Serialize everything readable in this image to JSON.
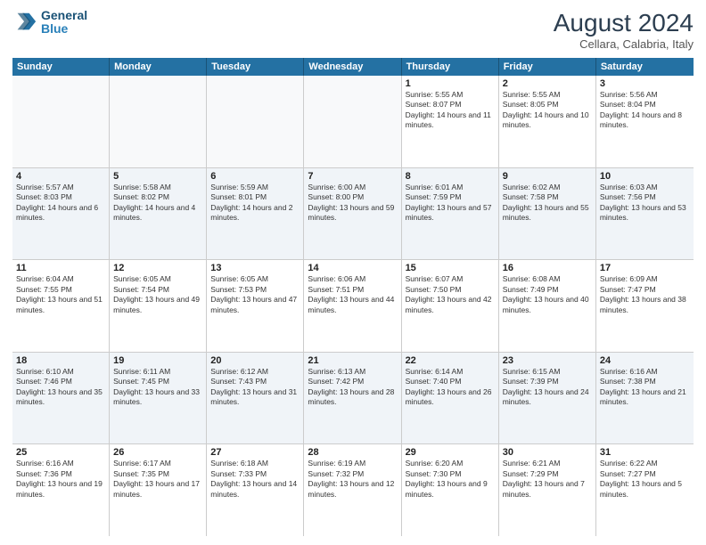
{
  "logo": {
    "line1": "General",
    "line2": "Blue"
  },
  "title": "August 2024",
  "subtitle": "Cellara, Calabria, Italy",
  "days": [
    "Sunday",
    "Monday",
    "Tuesday",
    "Wednesday",
    "Thursday",
    "Friday",
    "Saturday"
  ],
  "weeks": [
    [
      {
        "day": "",
        "empty": true
      },
      {
        "day": "",
        "empty": true
      },
      {
        "day": "",
        "empty": true
      },
      {
        "day": "",
        "empty": true
      },
      {
        "day": "1",
        "sunrise": "Sunrise: 5:55 AM",
        "sunset": "Sunset: 8:07 PM",
        "daylight": "Daylight: 14 hours and 11 minutes."
      },
      {
        "day": "2",
        "sunrise": "Sunrise: 5:55 AM",
        "sunset": "Sunset: 8:05 PM",
        "daylight": "Daylight: 14 hours and 10 minutes."
      },
      {
        "day": "3",
        "sunrise": "Sunrise: 5:56 AM",
        "sunset": "Sunset: 8:04 PM",
        "daylight": "Daylight: 14 hours and 8 minutes."
      }
    ],
    [
      {
        "day": "4",
        "sunrise": "Sunrise: 5:57 AM",
        "sunset": "Sunset: 8:03 PM",
        "daylight": "Daylight: 14 hours and 6 minutes."
      },
      {
        "day": "5",
        "sunrise": "Sunrise: 5:58 AM",
        "sunset": "Sunset: 8:02 PM",
        "daylight": "Daylight: 14 hours and 4 minutes."
      },
      {
        "day": "6",
        "sunrise": "Sunrise: 5:59 AM",
        "sunset": "Sunset: 8:01 PM",
        "daylight": "Daylight: 14 hours and 2 minutes."
      },
      {
        "day": "7",
        "sunrise": "Sunrise: 6:00 AM",
        "sunset": "Sunset: 8:00 PM",
        "daylight": "Daylight: 13 hours and 59 minutes."
      },
      {
        "day": "8",
        "sunrise": "Sunrise: 6:01 AM",
        "sunset": "Sunset: 7:59 PM",
        "daylight": "Daylight: 13 hours and 57 minutes."
      },
      {
        "day": "9",
        "sunrise": "Sunrise: 6:02 AM",
        "sunset": "Sunset: 7:58 PM",
        "daylight": "Daylight: 13 hours and 55 minutes."
      },
      {
        "day": "10",
        "sunrise": "Sunrise: 6:03 AM",
        "sunset": "Sunset: 7:56 PM",
        "daylight": "Daylight: 13 hours and 53 minutes."
      }
    ],
    [
      {
        "day": "11",
        "sunrise": "Sunrise: 6:04 AM",
        "sunset": "Sunset: 7:55 PM",
        "daylight": "Daylight: 13 hours and 51 minutes."
      },
      {
        "day": "12",
        "sunrise": "Sunrise: 6:05 AM",
        "sunset": "Sunset: 7:54 PM",
        "daylight": "Daylight: 13 hours and 49 minutes."
      },
      {
        "day": "13",
        "sunrise": "Sunrise: 6:05 AM",
        "sunset": "Sunset: 7:53 PM",
        "daylight": "Daylight: 13 hours and 47 minutes."
      },
      {
        "day": "14",
        "sunrise": "Sunrise: 6:06 AM",
        "sunset": "Sunset: 7:51 PM",
        "daylight": "Daylight: 13 hours and 44 minutes."
      },
      {
        "day": "15",
        "sunrise": "Sunrise: 6:07 AM",
        "sunset": "Sunset: 7:50 PM",
        "daylight": "Daylight: 13 hours and 42 minutes."
      },
      {
        "day": "16",
        "sunrise": "Sunrise: 6:08 AM",
        "sunset": "Sunset: 7:49 PM",
        "daylight": "Daylight: 13 hours and 40 minutes."
      },
      {
        "day": "17",
        "sunrise": "Sunrise: 6:09 AM",
        "sunset": "Sunset: 7:47 PM",
        "daylight": "Daylight: 13 hours and 38 minutes."
      }
    ],
    [
      {
        "day": "18",
        "sunrise": "Sunrise: 6:10 AM",
        "sunset": "Sunset: 7:46 PM",
        "daylight": "Daylight: 13 hours and 35 minutes."
      },
      {
        "day": "19",
        "sunrise": "Sunrise: 6:11 AM",
        "sunset": "Sunset: 7:45 PM",
        "daylight": "Daylight: 13 hours and 33 minutes."
      },
      {
        "day": "20",
        "sunrise": "Sunrise: 6:12 AM",
        "sunset": "Sunset: 7:43 PM",
        "daylight": "Daylight: 13 hours and 31 minutes."
      },
      {
        "day": "21",
        "sunrise": "Sunrise: 6:13 AM",
        "sunset": "Sunset: 7:42 PM",
        "daylight": "Daylight: 13 hours and 28 minutes."
      },
      {
        "day": "22",
        "sunrise": "Sunrise: 6:14 AM",
        "sunset": "Sunset: 7:40 PM",
        "daylight": "Daylight: 13 hours and 26 minutes."
      },
      {
        "day": "23",
        "sunrise": "Sunrise: 6:15 AM",
        "sunset": "Sunset: 7:39 PM",
        "daylight": "Daylight: 13 hours and 24 minutes."
      },
      {
        "day": "24",
        "sunrise": "Sunrise: 6:16 AM",
        "sunset": "Sunset: 7:38 PM",
        "daylight": "Daylight: 13 hours and 21 minutes."
      }
    ],
    [
      {
        "day": "25",
        "sunrise": "Sunrise: 6:16 AM",
        "sunset": "Sunset: 7:36 PM",
        "daylight": "Daylight: 13 hours and 19 minutes."
      },
      {
        "day": "26",
        "sunrise": "Sunrise: 6:17 AM",
        "sunset": "Sunset: 7:35 PM",
        "daylight": "Daylight: 13 hours and 17 minutes."
      },
      {
        "day": "27",
        "sunrise": "Sunrise: 6:18 AM",
        "sunset": "Sunset: 7:33 PM",
        "daylight": "Daylight: 13 hours and 14 minutes."
      },
      {
        "day": "28",
        "sunrise": "Sunrise: 6:19 AM",
        "sunset": "Sunset: 7:32 PM",
        "daylight": "Daylight: 13 hours and 12 minutes."
      },
      {
        "day": "29",
        "sunrise": "Sunrise: 6:20 AM",
        "sunset": "Sunset: 7:30 PM",
        "daylight": "Daylight: 13 hours and 9 minutes."
      },
      {
        "day": "30",
        "sunrise": "Sunrise: 6:21 AM",
        "sunset": "Sunset: 7:29 PM",
        "daylight": "Daylight: 13 hours and 7 minutes."
      },
      {
        "day": "31",
        "sunrise": "Sunrise: 6:22 AM",
        "sunset": "Sunset: 7:27 PM",
        "daylight": "Daylight: 13 hours and 5 minutes."
      }
    ]
  ]
}
